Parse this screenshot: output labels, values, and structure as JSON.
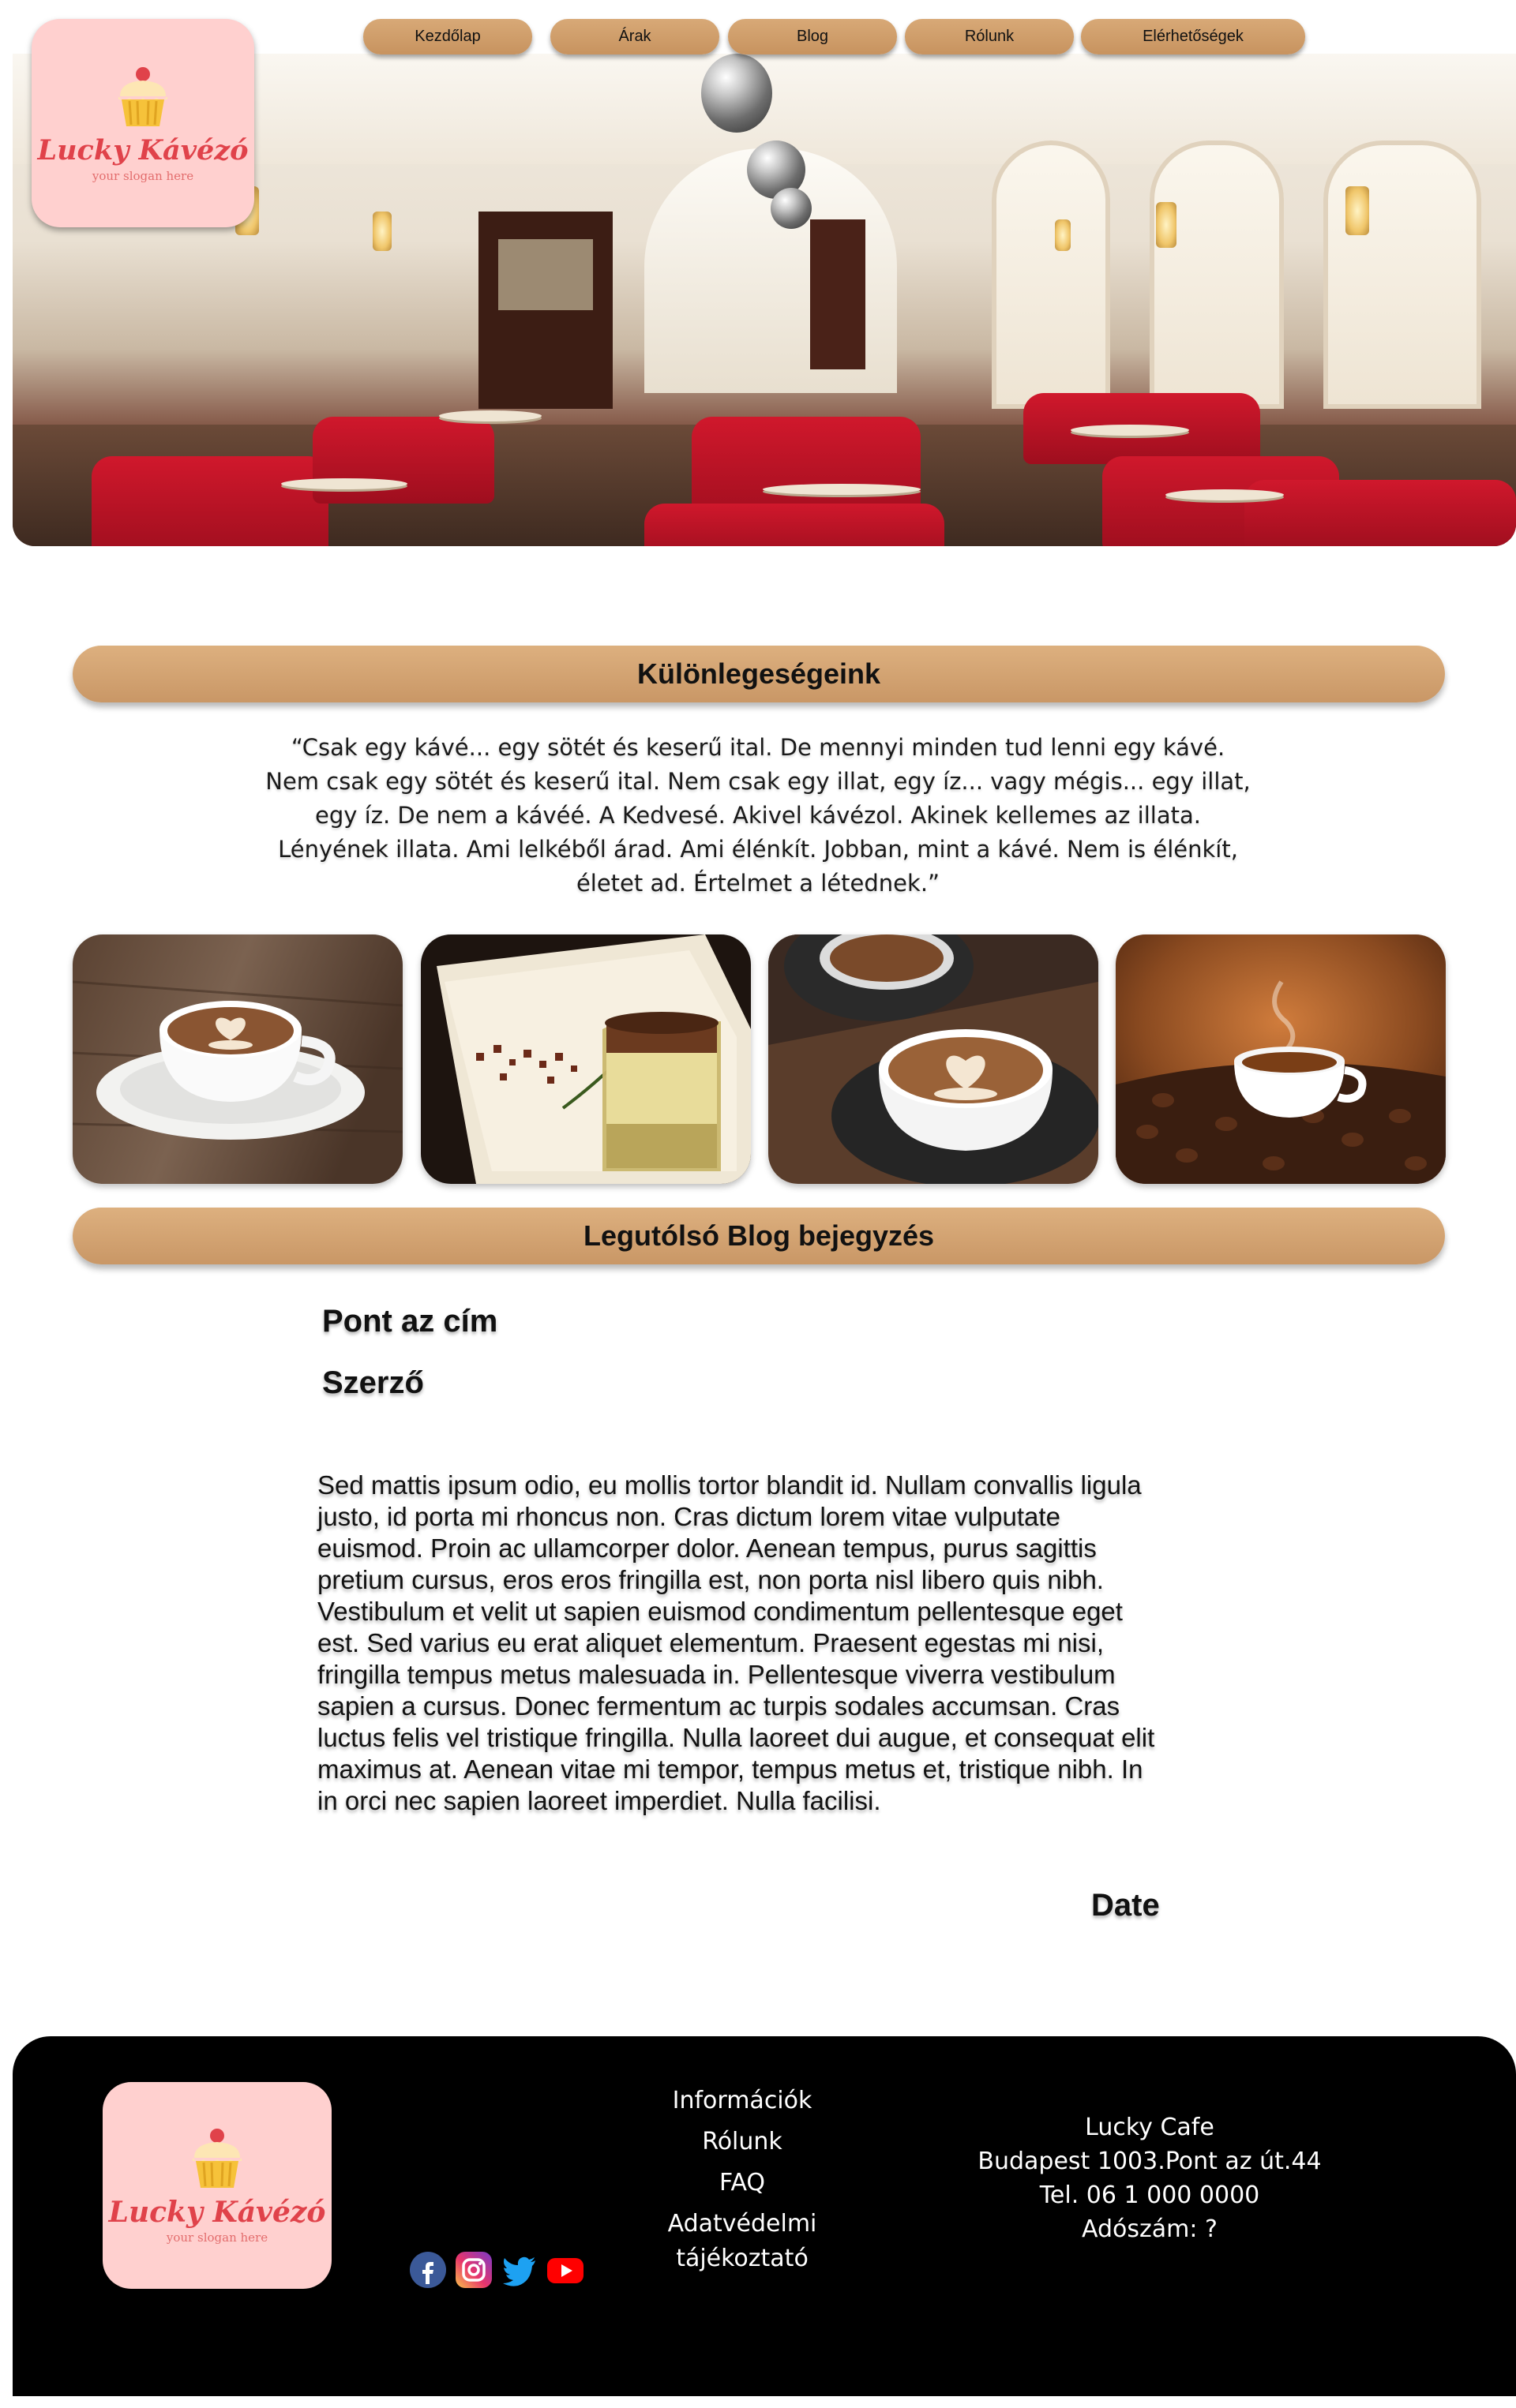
{
  "nav": {
    "items": [
      "Kezdőlap",
      "Árak",
      "Blog",
      "Rólunk",
      "Elérhetőségek"
    ]
  },
  "logo": {
    "name": "Lucky Kávézó",
    "slogan": "your slogan here"
  },
  "specials": {
    "heading": "Különlegeségeink",
    "quote_lines": [
      "“Csak egy kávé... egy sötét és keserű ital. De mennyi minden tud lenni egy kávé.",
      "Nem csak egy sötét és keserű ital. Nem csak egy illat, egy íz... vagy mégis... egy illat,",
      "egy íz. De nem a kávéé. A Kedvesé. Akivel kávézol. Akinek kellemes az illata.",
      "Lényének illata. Ami lelkéből árad. Ami élénkít. Jobban, mint a kávé. Nem is élénkít,",
      "életet ad. Értelmet a létednek.”"
    ]
  },
  "blog": {
    "heading": "Legutólsó Blog bejegyzés",
    "title": "Pont az cím",
    "author": "Szerző",
    "body_lines": [
      "Sed mattis ipsum odio, eu mollis tortor blandit id. Nullam convallis ligula",
      "justo, id porta mi rhoncus non. Cras dictum lorem vitae vulputate",
      "euismod. Proin ac ullamcorper dolor. Aenean tempus, purus sagittis",
      "pretium cursus, eros eros fringilla est, non porta nisl libero quis nibh.",
      "Vestibulum et velit ut sapien euismod condimentum pellentesque eget",
      "est. Sed varius eu erat aliquet elementum. Praesent egestas mi nisi,",
      "fringilla tempus metus malesuada in. Pellentesque viverra vestibulum",
      "sapien a cursus. Donec fermentum ac turpis sodales accumsan. Cras",
      "luctus felis vel tristique fringilla. Nulla laoreet dui augue, et consequat elit",
      "maximus at. Aenean vitae mi tempor, tempus metus et, tristique nibh. In",
      "in orci nec sapien laoreet imperdiet. Nulla facilisi."
    ],
    "date": "Date"
  },
  "footer": {
    "links": [
      "Információk",
      "Rólunk",
      "FAQ",
      "Adatvédelmi tájékoztató"
    ],
    "contact": [
      "Lucky Cafe",
      "Budapest 1003.Pont az út.44",
      "Tel. 06 1 000 0000",
      "Adószám: ?"
    ],
    "social_icons": [
      "facebook-icon",
      "instagram-icon",
      "twitter-icon",
      "youtube-icon"
    ]
  },
  "colors": {
    "accent": "#cf9d6b",
    "logo_bg": "#ffd0cf",
    "logo_text": "#e0424a",
    "footer_bg": "#000000"
  }
}
